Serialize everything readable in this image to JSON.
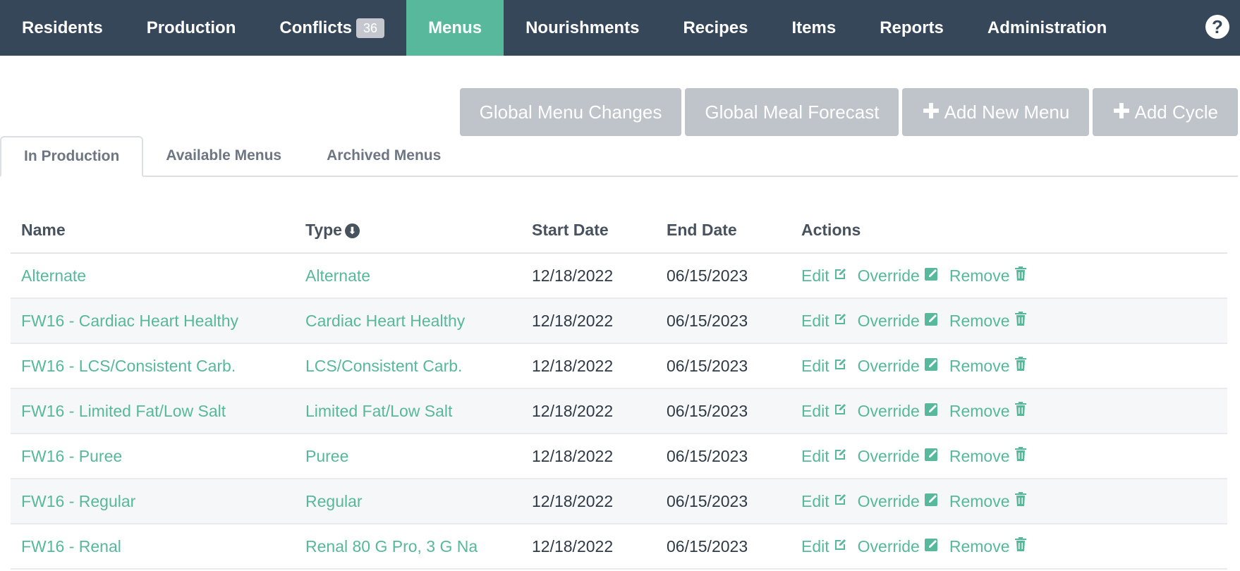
{
  "nav": {
    "items": [
      {
        "label": "Residents"
      },
      {
        "label": "Production"
      },
      {
        "label": "Conflicts",
        "badge": "36"
      },
      {
        "label": "Menus",
        "active": true
      },
      {
        "label": "Nourishments"
      },
      {
        "label": "Recipes"
      },
      {
        "label": "Items"
      },
      {
        "label": "Reports"
      },
      {
        "label": "Administration"
      }
    ],
    "help_label": "?"
  },
  "buttons": {
    "global_menu_changes": "Global Menu Changes",
    "global_meal_forecast": "Global Meal Forecast",
    "add_new_menu": "Add New Menu",
    "add_cycle": "Add Cycle"
  },
  "tabs": [
    {
      "label": "In Production",
      "active": true
    },
    {
      "label": "Available Menus"
    },
    {
      "label": "Archived Menus"
    }
  ],
  "table": {
    "headers": {
      "name": "Name",
      "type": "Type",
      "start": "Start Date",
      "end": "End Date",
      "actions": "Actions"
    },
    "action_labels": {
      "edit": "Edit",
      "override": "Override",
      "remove": "Remove"
    },
    "rows": [
      {
        "name": "Alternate",
        "type": "Alternate",
        "start": "12/18/2022",
        "end": "06/15/2023"
      },
      {
        "name": "FW16 - Cardiac Heart Healthy",
        "type": "Cardiac Heart Healthy",
        "start": "12/18/2022",
        "end": "06/15/2023"
      },
      {
        "name": "FW16 - LCS/Consistent Carb.",
        "type": "LCS/Consistent Carb.",
        "start": "12/18/2022",
        "end": "06/15/2023"
      },
      {
        "name": "FW16 - Limited Fat/Low Salt",
        "type": "Limited Fat/Low Salt",
        "start": "12/18/2022",
        "end": "06/15/2023"
      },
      {
        "name": "FW16 - Puree",
        "type": "Puree",
        "start": "12/18/2022",
        "end": "06/15/2023"
      },
      {
        "name": "FW16 - Regular",
        "type": "Regular",
        "start": "12/18/2022",
        "end": "06/15/2023"
      },
      {
        "name": "FW16 - Renal",
        "type": "Renal 80 G Pro, 3 G Na",
        "start": "12/18/2022",
        "end": "06/15/2023"
      }
    ]
  },
  "colors": {
    "nav_bg": "#37475a",
    "accent": "#57b89b",
    "button_gray": "#bfc4ca"
  }
}
